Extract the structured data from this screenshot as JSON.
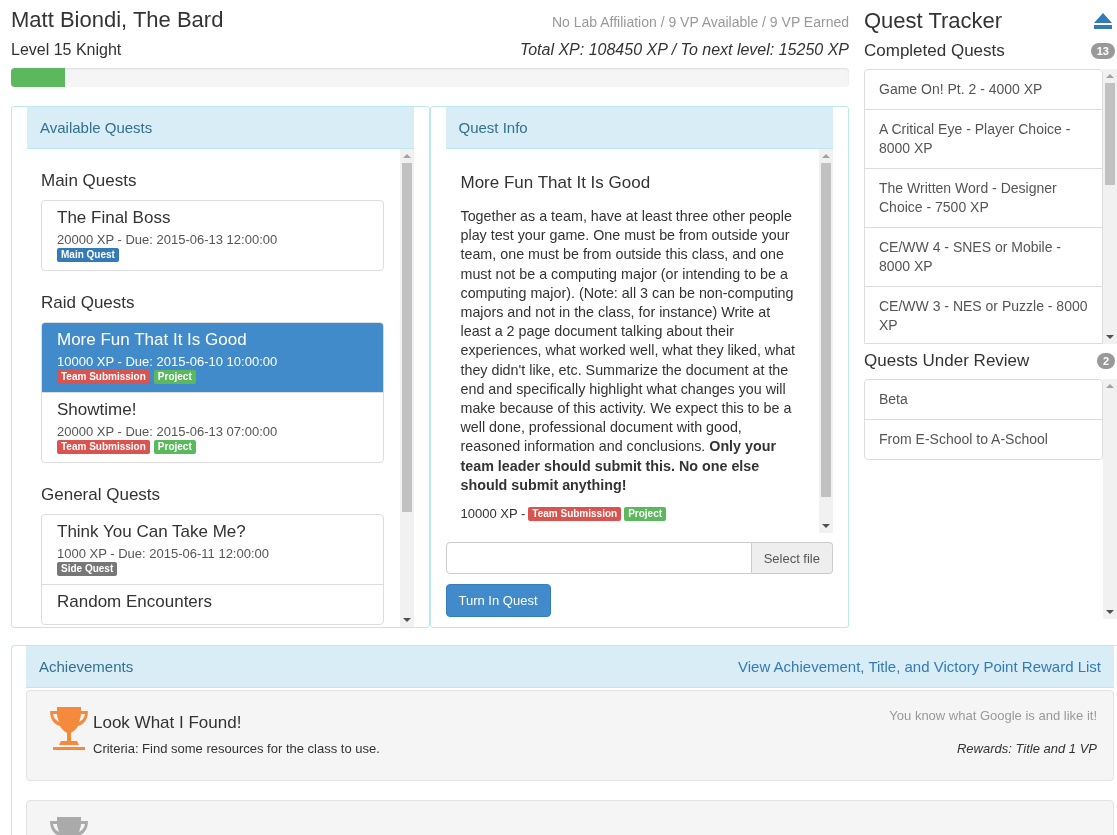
{
  "header": {
    "name": "Matt Biondi, The Bard",
    "level": "Level 15 Knight",
    "affiliation": "No Lab Affiliation / 9 VP Available / 9 VP Earned",
    "xp_summary": "Total XP: 108450 XP / To next level: 15250 XP",
    "progress": {
      "level": 0.064
    }
  },
  "available_quests": {
    "title": "Available Quests",
    "groups": [
      {
        "heading": "Main Quests",
        "quests": [
          {
            "title": "The Final Boss",
            "meta": "20000 XP - Due: 2015-06-13 12:00:00",
            "selected": false,
            "tags": [
              {
                "label": "Main Quest",
                "color": "#337ab7"
              }
            ]
          }
        ]
      },
      {
        "heading": "Raid Quests",
        "quests": [
          {
            "title": "More Fun That It Is Good",
            "meta": "10000 XP - Due: 2015-06-10 10:00:00",
            "selected": true,
            "tags": [
              {
                "label": "Team Submission",
                "color": "#d9534f"
              },
              {
                "label": "Project",
                "color": "#5cb85c"
              }
            ]
          },
          {
            "title": "Showtime!",
            "meta": "20000 XP - Due: 2015-06-13 07:00:00",
            "selected": false,
            "tags": [
              {
                "label": "Team Submission",
                "color": "#d9534f"
              },
              {
                "label": "Project",
                "color": "#5cb85c"
              }
            ]
          }
        ]
      },
      {
        "heading": "General Quests",
        "quests": [
          {
            "title": "Think You Can Take Me?",
            "meta": "1000 XP - Due: 2015-06-11 12:00:00",
            "selected": false,
            "tags": [
              {
                "label": "Side Quest",
                "color": "#777777"
              }
            ]
          },
          {
            "title": "Random Encounters",
            "selected": false
          }
        ]
      }
    ]
  },
  "quest_info": {
    "title": "Quest Info",
    "quest_title": "More Fun That It Is Good",
    "description": "Together as a team, have at least three other people play test your game. One must be from outside your team, one must be from outside this class, and one must not be a computing major (or intending to be a computing major). (Note: all 3 can be non-computing majors and not in the class, for instance) Write at least a 2 page document talking about their experiences, what worked well, what they liked, what they didn't like, etc. Summarize the document at the end and specifically highlight what changes you will make because of this activity. We expect this to be a well done, professional document with good, reasoned information and conclusions. **Only your team leader should submit this. No one else should submit anything!**",
    "xp": "10000 XP -",
    "tags": [
      {
        "label": "Team Submission",
        "color": "#d9534f"
      },
      {
        "label": "Project",
        "color": "#5cb85c"
      }
    ],
    "file_button": "Select file",
    "submit_button": "Turn In Quest"
  },
  "tracker": {
    "title": "Quest Tracker",
    "completed": {
      "heading": "Completed Quests",
      "count": "13",
      "items": [
        "Game On! Pt. 2 - 4000 XP",
        "A Critical Eye - Player Choice - 8000 XP",
        "The Written Word - Designer Choice - 7500 XP",
        "CE/WW 4 - SNES or Mobile - 8000 XP",
        "CE/WW 3 - NES or Puzzle - 8000 XP"
      ]
    },
    "review": {
      "heading": "Quests Under Review",
      "count": "2",
      "items": [
        "Beta",
        "From E-School to A-School"
      ]
    }
  },
  "achievements": {
    "title": "Achievements",
    "link": "View Achievement, Title, and Victory Point Reward List",
    "items": [
      {
        "color": "#f58a3c",
        "title": "Look What I Found!",
        "criteria": "Criteria: Find some resources for the class to use.",
        "flavor": "You know what Google is and like it!",
        "rewards": "Rewards: Title and 1 VP"
      },
      {
        "color": "#aaaaaa"
      }
    ]
  }
}
